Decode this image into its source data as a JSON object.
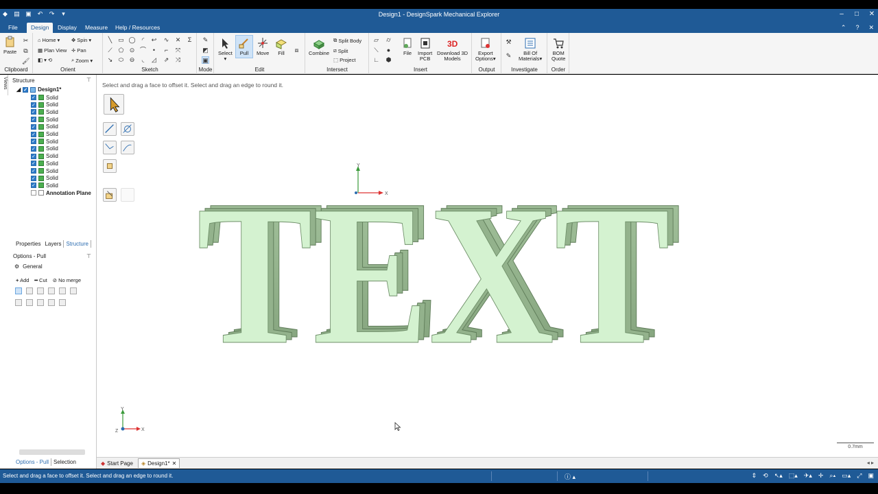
{
  "window": {
    "title": "Design1 - DesignSpark Mechanical Explorer",
    "min": "–",
    "max": "□",
    "close": "✕"
  },
  "menu": {
    "tabs": [
      "File",
      "Design",
      "Display",
      "Measure",
      "Help / Resources"
    ],
    "active": "Design"
  },
  "ribbon": {
    "clipboard": {
      "paste": "Paste",
      "label": "Clipboard"
    },
    "orient": {
      "home": "Home",
      "spin": "Spin",
      "plan_view": "Plan View",
      "pan": "Pan",
      "zoom": "Zoom",
      "label": "Orient"
    },
    "sketch": {
      "label": "Sketch"
    },
    "mode": {
      "label": "Mode"
    },
    "edit": {
      "select": "Select",
      "pull": "Pull",
      "move": "Move",
      "fill": "Fill",
      "label": "Edit"
    },
    "intersect": {
      "combine": "Combine",
      "split_body": "Split Body",
      "split": "Split",
      "project": "Project",
      "label": "Intersect"
    },
    "insert": {
      "file": "File",
      "import_pcb_1": "Import",
      "import_pcb_2": "PCB",
      "download_1": "Download 3D",
      "download_2": "Models",
      "label": "Insert"
    },
    "output": {
      "export_1": "Export",
      "export_2": "Options",
      "label": "Output"
    },
    "investigate": {
      "bom_1": "Bill Of",
      "bom_2": "Materials",
      "label": "Investigate"
    },
    "order": {
      "bom_quote_1": "BOM",
      "bom_quote_2": "Quote",
      "label": "Order"
    }
  },
  "structure": {
    "panel_title": "Structure",
    "views_tab": "Views",
    "root": "Design1*",
    "items": [
      "Solid",
      "Solid",
      "Solid",
      "Solid",
      "Solid",
      "Solid",
      "Solid",
      "Solid",
      "Solid",
      "Solid",
      "Solid",
      "Solid",
      "Solid"
    ],
    "annotation_plane": "Annotation Plane"
  },
  "panel_tabs": [
    "Properties",
    "Layers",
    "Structure"
  ],
  "options": {
    "title": "Options - Pull",
    "general": "General",
    "add": "Add",
    "cut": "Cut",
    "no_merge": "No merge"
  },
  "bottom_tabs": [
    "Options - Pull",
    "Selection"
  ],
  "viewport": {
    "hint": "Select and drag a face to offset it. Select and drag an edge to round it.",
    "model_text": "TEXT",
    "scale": "0.7mm",
    "axis_x": "X",
    "axis_y": "Y",
    "axis_z": "Z"
  },
  "doc_tabs": {
    "start": "Start Page",
    "design": "Design1*"
  },
  "status": {
    "message": "Select and drag a face to offset it. Select and drag an edge to round it."
  },
  "colors": {
    "title_blue": "#1f5a96",
    "model_face": "#d4f2d0",
    "model_side": "#8fae88"
  }
}
